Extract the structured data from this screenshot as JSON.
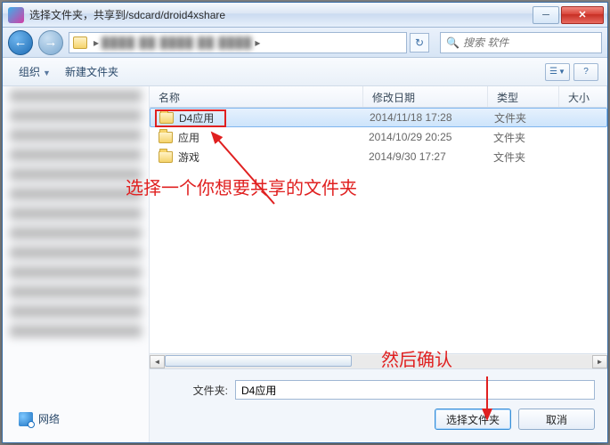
{
  "window": {
    "title": "选择文件夹，共享到/sdcard/droid4xshare",
    "close_glyph": "✕",
    "min_glyph": "─"
  },
  "nav": {
    "back_glyph": "←",
    "fwd_glyph": "→",
    "refresh_glyph": "↻",
    "crumb_sep": "▸"
  },
  "search": {
    "placeholder": "搜索 软件"
  },
  "toolbar": {
    "organize": "组织",
    "newfolder": "新建文件夹",
    "arrow": "▼",
    "view_glyph": "☰",
    "help_glyph": "?"
  },
  "columns": {
    "name": "名称",
    "date": "修改日期",
    "type": "类型",
    "size": "大小"
  },
  "rows": [
    {
      "name": "D4应用",
      "date": "2014/11/18 17:28",
      "type": "文件夹",
      "selected": true
    },
    {
      "name": "应用",
      "date": "2014/10/29 20:25",
      "type": "文件夹",
      "selected": false
    },
    {
      "name": "游戏",
      "date": "2014/9/30 17:27",
      "type": "文件夹",
      "selected": false
    }
  ],
  "sidebar": {
    "network": "网络"
  },
  "bottom": {
    "label": "文件夹:",
    "value": "D4应用",
    "select": "选择文件夹",
    "cancel": "取消"
  },
  "annotations": {
    "a1": "选择一个你想要共享的文件夹",
    "a2": "然后确认"
  },
  "hscroll": {
    "left": "◄",
    "right": "►"
  }
}
